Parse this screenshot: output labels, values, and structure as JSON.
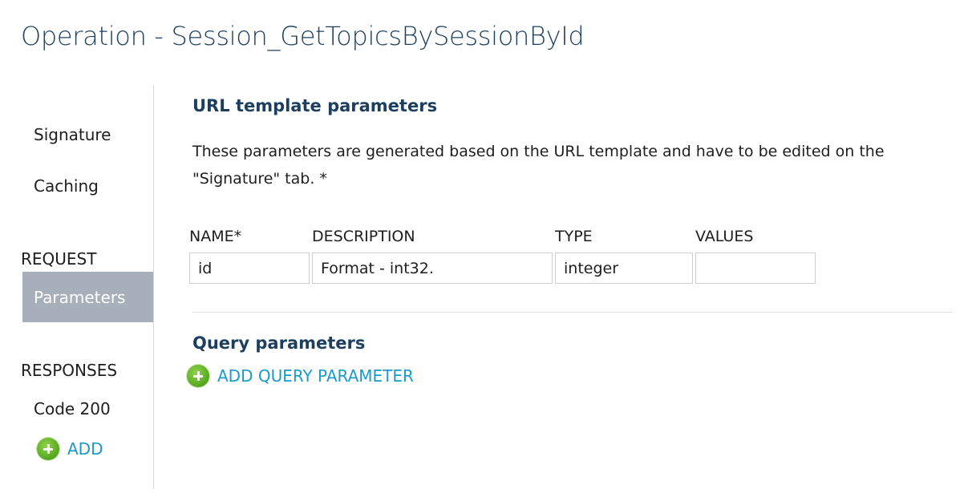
{
  "page": {
    "title": "Operation - Session_GetTopicsBySessionById"
  },
  "sidebar": {
    "items": [
      {
        "label": "Signature"
      },
      {
        "label": "Caching"
      }
    ],
    "request_heading": "REQUEST",
    "request_items": [
      {
        "label": "Parameters",
        "active": true
      }
    ],
    "responses_heading": "RESPONSES",
    "response_items": [
      {
        "label": "Code 200"
      }
    ],
    "add_label": "ADD",
    "add_icon": "plus-circle-icon"
  },
  "url_params": {
    "title": "URL template parameters",
    "description": "These parameters are generated based on the URL template and have to be edited on the \"Signature\" tab. *",
    "columns": [
      "NAME*",
      "DESCRIPTION",
      "TYPE",
      "VALUES"
    ],
    "rows": [
      {
        "name": "id",
        "description": "Format - int32.",
        "type": "integer",
        "values": ""
      }
    ]
  },
  "query_params": {
    "title": "Query parameters",
    "add_label": "ADD QUERY PARAMETER",
    "add_icon": "plus-circle-icon"
  },
  "colors": {
    "title": "#1d3f5f",
    "link": "#1a9ac9",
    "active_nav_bg": "#a7afbb",
    "add_icon_green": "#5cae24"
  }
}
